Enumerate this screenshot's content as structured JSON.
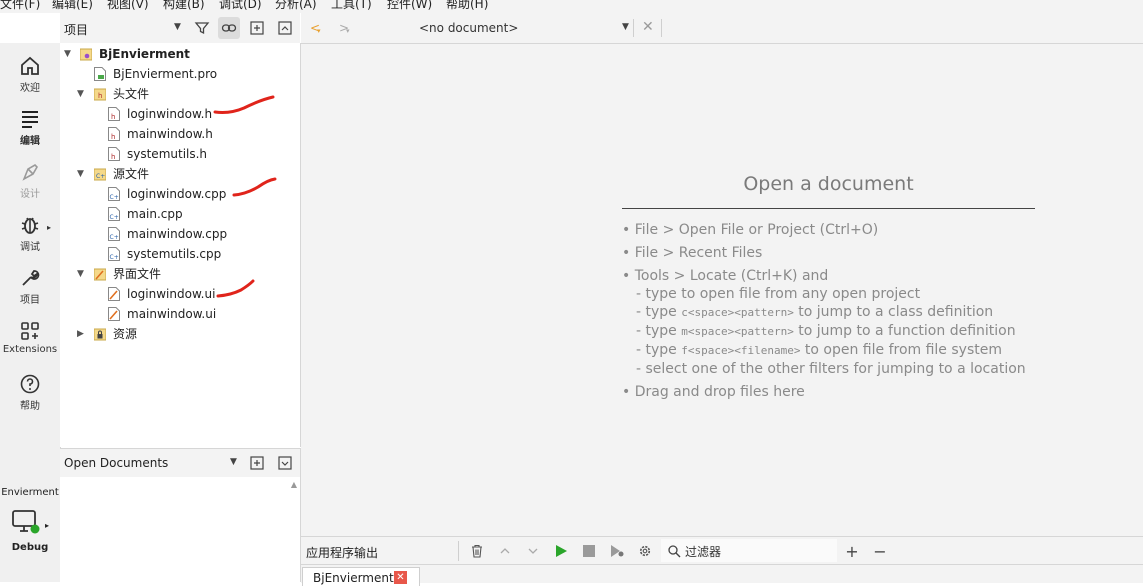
{
  "menu": [
    "文件(F)",
    "编辑(E)",
    "视图(V)",
    "构建(B)",
    "调试(D)",
    "分析(A)",
    "工具(T)",
    "控件(W)",
    "帮助(H)"
  ],
  "modes": [
    {
      "label": "欢迎",
      "icon": "home-icon"
    },
    {
      "label": "编辑",
      "icon": "edit-icon"
    },
    {
      "label": "设计",
      "icon": "design-icon"
    },
    {
      "label": "调试",
      "icon": "debug-icon"
    },
    {
      "label": "项目",
      "icon": "wrench-icon"
    },
    {
      "label": "Extensions",
      "icon": "extensions-icon"
    },
    {
      "label": "帮助",
      "icon": "help-icon"
    }
  ],
  "kit": {
    "project": "Envierment",
    "config": "Debug"
  },
  "project_pane": {
    "view_selector": "项目",
    "tree": [
      {
        "label": "BjEnvierment",
        "type": "project"
      },
      {
        "label": "BjEnvierment.pro",
        "type": "pro"
      },
      {
        "label": "头文件",
        "type": "folder-h"
      },
      {
        "label": "loginwindow.h",
        "type": "h"
      },
      {
        "label": "mainwindow.h",
        "type": "h"
      },
      {
        "label": "systemutils.h",
        "type": "h"
      },
      {
        "label": "源文件",
        "type": "folder-cpp"
      },
      {
        "label": "loginwindow.cpp",
        "type": "cpp"
      },
      {
        "label": "main.cpp",
        "type": "cpp"
      },
      {
        "label": "mainwindow.cpp",
        "type": "cpp"
      },
      {
        "label": "systemutils.cpp",
        "type": "cpp"
      },
      {
        "label": "界面文件",
        "type": "folder-ui"
      },
      {
        "label": "loginwindow.ui",
        "type": "ui"
      },
      {
        "label": "mainwindow.ui",
        "type": "ui"
      },
      {
        "label": "资源",
        "type": "folder-res"
      }
    ]
  },
  "open_documents": {
    "label": "Open Documents"
  },
  "editor": {
    "doc_selector": "<no document>",
    "welcome_title": "Open a document",
    "hints": [
      "• File > Open File or Project (Ctrl+O)",
      "• File > Recent Files",
      "• Tools > Locate (Ctrl+K) and",
      "• Drag and drop files here"
    ],
    "sub_hints": [
      {
        "pre": "- type to open file from any open project",
        "code": "",
        "post": ""
      },
      {
        "pre": "- type ",
        "code": "c<space><pattern>",
        "post": " to jump to a class definition"
      },
      {
        "pre": "- type ",
        "code": "m<space><pattern>",
        "post": " to jump to a function definition"
      },
      {
        "pre": "- type ",
        "code": "f<space><filename>",
        "post": " to open file from file system"
      },
      {
        "pre": "- select one of the other filters for jumping to a location",
        "code": "",
        "post": ""
      }
    ]
  },
  "output": {
    "label": "应用程序输出",
    "filter_placeholder": "过滤器",
    "tab": "BjEnvierment"
  },
  "colors": {
    "annotation": "#e0241b",
    "run": "#2aa52a",
    "accent_orange": "#e8a030"
  }
}
